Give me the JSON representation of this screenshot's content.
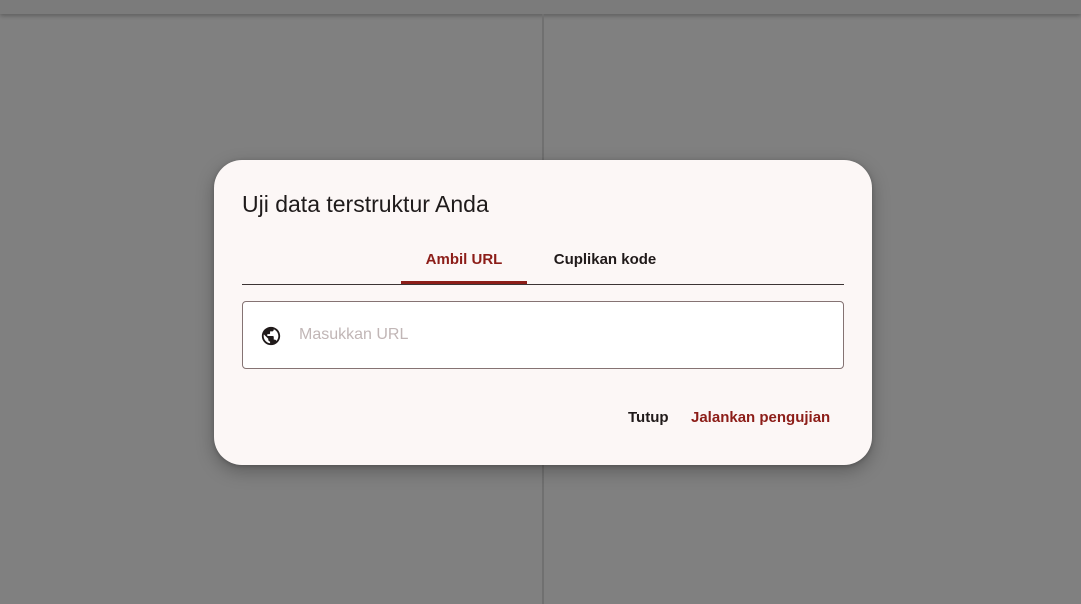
{
  "dialog": {
    "title": "Uji data terstruktur Anda",
    "tabs": [
      {
        "label": "Ambil URL",
        "selected": true
      },
      {
        "label": "Cuplikan kode",
        "selected": false
      }
    ],
    "url_field": {
      "icon": "globe-icon",
      "placeholder": "Masukkan URL",
      "value": ""
    },
    "actions": {
      "close_label": "Tutup",
      "run_label": "Jalankan pengujian"
    }
  },
  "colors": {
    "accent": "#8c1d18",
    "dialog_background": "#fcf7f6",
    "scrim": "#808080"
  }
}
